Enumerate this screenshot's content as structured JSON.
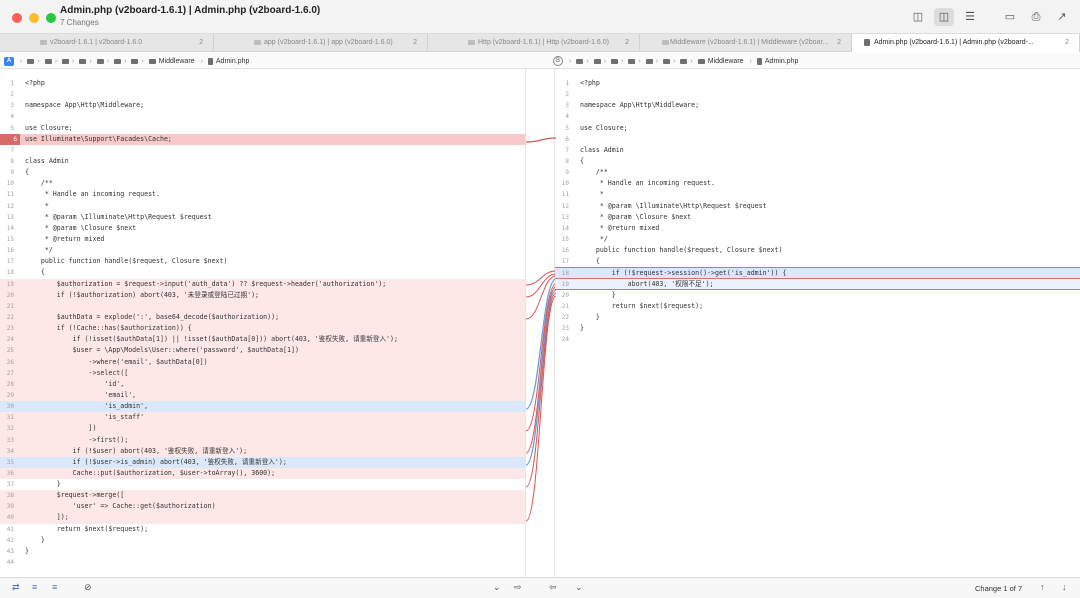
{
  "window": {
    "title": "Admin.php (v2board-1.6.1) | Admin.php (v2board-1.6.0)",
    "subtitle": "7 Changes"
  },
  "toolbar_icons": [
    "sidebar-icon",
    "split-view-icon",
    "unified-view-icon",
    "window-icon",
    "share-icon",
    "export-icon"
  ],
  "tabs": [
    {
      "label": "v2board-1.6.1 | v2board-1.6.0",
      "count": "2"
    },
    {
      "label": "app (v2board-1.6.1) | app (v2board-1.6.0)",
      "count": "2"
    },
    {
      "label": "Http (v2board-1.6.1) | Http (v2board-1.6.0)",
      "count": "2"
    },
    {
      "label": "Middleware (v2board-1.6.1) | Middleware (v2boar...",
      "count": "2"
    },
    {
      "label": "Admin.php (v2board-1.6.1) | Admin.php (v2board-...",
      "count": "2"
    }
  ],
  "path": {
    "left_badge": "A",
    "right_badge": "B",
    "folder": "Middleware",
    "file": "Admin.php"
  },
  "left_lines": [
    {
      "n": "1",
      "t": "<?php"
    },
    {
      "n": "2",
      "t": ""
    },
    {
      "n": "3",
      "t": "namespace App\\Http\\Middleware;"
    },
    {
      "n": "4",
      "t": ""
    },
    {
      "n": "5",
      "t": "use Closure;"
    },
    {
      "n": "6",
      "t": "use Illuminate\\Support\\Facades\\Cache;"
    },
    {
      "n": "7",
      "t": ""
    },
    {
      "n": "8",
      "t": "class Admin"
    },
    {
      "n": "9",
      "t": "{"
    },
    {
      "n": "10",
      "t": "    /**"
    },
    {
      "n": "11",
      "t": "     * Handle an incoming request."
    },
    {
      "n": "12",
      "t": "     *"
    },
    {
      "n": "13",
      "t": "     * @param \\Illuminate\\Http\\Request $request"
    },
    {
      "n": "14",
      "t": "     * @param \\Closure $next"
    },
    {
      "n": "15",
      "t": "     * @return mixed"
    },
    {
      "n": "16",
      "t": "     */"
    },
    {
      "n": "17",
      "t": "    public function handle($request, Closure $next)"
    },
    {
      "n": "18",
      "t": "    {"
    },
    {
      "n": "19",
      "t": "        $authorization = $request->input('auth_data') ?? $request->header('authorization');"
    },
    {
      "n": "20",
      "t": "        if (!$authorization) abort(403, '未登录或登陆已过期');"
    },
    {
      "n": "21",
      "t": ""
    },
    {
      "n": "22",
      "t": "        $authData = explode(':', base64_decode($authorization));"
    },
    {
      "n": "23",
      "t": "        if (!Cache::has($authorization)) {"
    },
    {
      "n": "24",
      "t": "            if (!isset($authData[1]) || !isset($authData[0])) abort(403, '鉴权失败, 请重新登入');"
    },
    {
      "n": "25",
      "t": "            $user = \\App\\Models\\User::where('password', $authData[1])"
    },
    {
      "n": "26",
      "t": "                ->where('email', $authData[0])"
    },
    {
      "n": "27",
      "t": "                ->select(["
    },
    {
      "n": "28",
      "t": "                    'id',"
    },
    {
      "n": "29",
      "t": "                    'email',"
    },
    {
      "n": "30",
      "t": "                    'is_admin',"
    },
    {
      "n": "31",
      "t": "                    'is_staff'"
    },
    {
      "n": "32",
      "t": "                ])"
    },
    {
      "n": "33",
      "t": "                ->first();"
    },
    {
      "n": "34",
      "t": "            if (!$user) abort(403, '鉴权失败, 请重新登入');"
    },
    {
      "n": "35",
      "t": "            if (!$user->is_admin) abort(403, '鉴权失败, 请重新登入');"
    },
    {
      "n": "36",
      "t": "            Cache::put($authorization, $user->toArray(), 3600);"
    },
    {
      "n": "37",
      "t": "        }"
    },
    {
      "n": "38",
      "t": "        $request->merge(["
    },
    {
      "n": "39",
      "t": "            'user' => Cache::get($authorization)"
    },
    {
      "n": "40",
      "t": "        ]);"
    },
    {
      "n": "41",
      "t": "        return $next($request);"
    },
    {
      "n": "42",
      "t": "    }"
    },
    {
      "n": "43",
      "t": "}"
    },
    {
      "n": "44",
      "t": ""
    }
  ],
  "right_lines": [
    {
      "n": "1",
      "t": "<?php"
    },
    {
      "n": "2",
      "t": ""
    },
    {
      "n": "3",
      "t": "namespace App\\Http\\Middleware;"
    },
    {
      "n": "4",
      "t": ""
    },
    {
      "n": "5",
      "t": "use Closure;"
    },
    {
      "n": "6",
      "t": ""
    },
    {
      "n": "7",
      "t": "class Admin"
    },
    {
      "n": "8",
      "t": "{"
    },
    {
      "n": "9",
      "t": "    /**"
    },
    {
      "n": "10",
      "t": "     * Handle an incoming request."
    },
    {
      "n": "11",
      "t": "     *"
    },
    {
      "n": "12",
      "t": "     * @param \\Illuminate\\Http\\Request $request"
    },
    {
      "n": "13",
      "t": "     * @param \\Closure $next"
    },
    {
      "n": "14",
      "t": "     * @return mixed"
    },
    {
      "n": "15",
      "t": "     */"
    },
    {
      "n": "16",
      "t": "    public function handle($request, Closure $next)"
    },
    {
      "n": "17",
      "t": "    {"
    },
    {
      "n": "18",
      "t": "        if (!$request->session()->get('is_admin')) {"
    },
    {
      "n": "19",
      "t": "            abort(403, '权限不足');"
    },
    {
      "n": "20",
      "t": "        }"
    },
    {
      "n": "21",
      "t": "        return $next($request);"
    },
    {
      "n": "22",
      "t": "    }"
    },
    {
      "n": "23",
      "t": "}"
    },
    {
      "n": "24",
      "t": ""
    }
  ],
  "bottom": {
    "change_status": "Change 1 of 7"
  },
  "colors": {
    "deleted": "#fde7e7",
    "changed": "#d9e8fb",
    "connector_red": "#d9534f",
    "connector_blue": "#6a9de0"
  }
}
